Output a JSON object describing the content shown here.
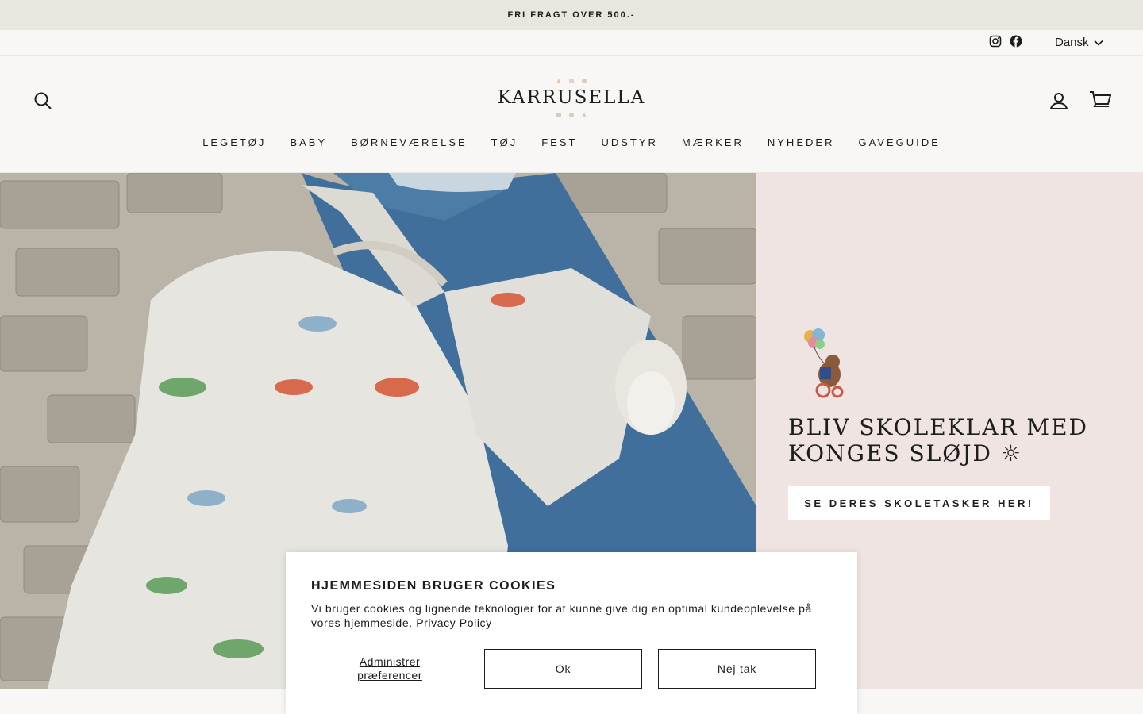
{
  "announcement": {
    "text": "FRI FRAGT OVER 500.-"
  },
  "utility": {
    "social_icons": [
      "instagram-icon",
      "facebook-icon"
    ],
    "language": "Dansk"
  },
  "header": {
    "brand": "KARRUSELLA",
    "icons": [
      "search-icon",
      "account-icon",
      "cart-icon"
    ],
    "nav": [
      "LEGETØJ",
      "BABY",
      "BØRNEVÆRELSE",
      "TØJ",
      "FEST",
      "UDSTYR",
      "MÆRKER",
      "NYHEDER",
      "GAVEGUIDE"
    ]
  },
  "hero": {
    "heading": "BLIV SKOLEKLAR MED KONGES SLØJD ☼",
    "cta": "SE DERES SKOLETASKER HER!",
    "image_subject": "child wearing race-car print backpack",
    "background": "#efe4e2"
  },
  "cookie_banner": {
    "title": "HJEMMESIDEN BRUGER COOKIES",
    "body": "Vi bruger cookies og lignende teknologier for at kunne give dig en optimal kundeoplevelse på vores hjemmeside.",
    "link": "Privacy Policy",
    "manage": "Administrer præferencer",
    "accept": "Ok",
    "decline": "Nej tak"
  }
}
